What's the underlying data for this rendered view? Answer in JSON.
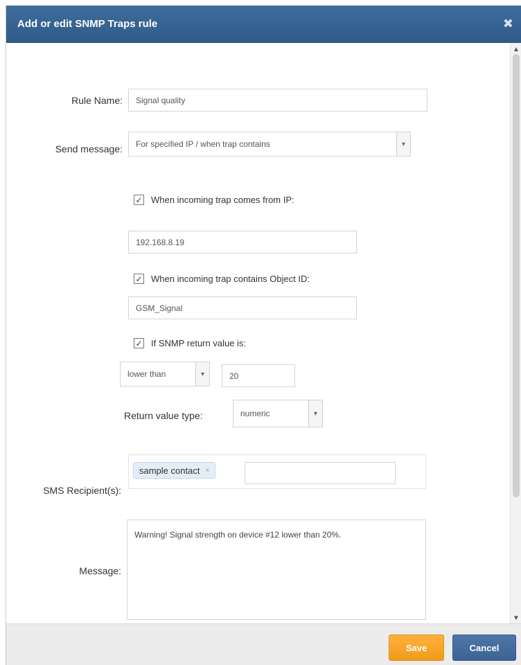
{
  "dialog": {
    "title": "Add or edit SNMP Traps rule",
    "close_glyph": "✖"
  },
  "form": {
    "rule_name_label": "Rule Name:",
    "rule_name_value": "Signal quality",
    "send_message_label": "Send message:",
    "send_message_value": "For specified IP / when trap contains",
    "from_ip_check_label": "When incoming trap comes from IP:",
    "from_ip_checked": true,
    "ip_value": "192.168.8.19",
    "object_id_check_label": "When incoming trap contains Object ID:",
    "object_id_checked": true,
    "object_id_value": "GSM_Signal",
    "return_check_label": "If SNMP return value is:",
    "return_checked": true,
    "comparison_value": "lower than",
    "threshold_value": "20",
    "return_type_label": "Return value type:",
    "return_type_value": "numeric",
    "sms_recipients_label": "SMS Recipient(s):",
    "recipients": [
      "sample contact"
    ],
    "recipient_input_value": "",
    "message_label": "Message:",
    "message_value": "Warning! Signal strength on device #12 lower than 20%."
  },
  "footer": {
    "save_label": "Save",
    "cancel_label": "Cancel"
  },
  "colors": {
    "titlebar": "#35608f",
    "save": "#f7a124",
    "cancel": "#456c9e"
  }
}
